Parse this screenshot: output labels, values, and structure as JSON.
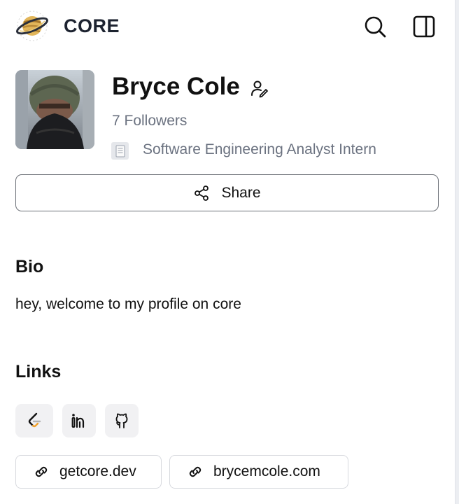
{
  "header": {
    "brand": "CORE",
    "logo_icon": "planet-logo-icon",
    "search_icon": "search-icon",
    "sidebar_icon": "sidebar-toggle-icon"
  },
  "profile": {
    "name": "Bryce Cole",
    "followers": "7 Followers",
    "role": "Software Engineering Analyst Intern",
    "avatar_icon": "profile-photo",
    "edit_icon": "user-edit-icon"
  },
  "share": {
    "label": "Share",
    "icon": "share-icon"
  },
  "bio": {
    "title": "Bio",
    "text": "hey, welcome to my profile on core"
  },
  "links": {
    "title": "Links",
    "social": [
      {
        "icon": "leetcode-icon"
      },
      {
        "icon": "linkedin-icon"
      },
      {
        "icon": "github-icon"
      }
    ],
    "urls": [
      {
        "label": "getcore.dev",
        "icon": "link-icon"
      },
      {
        "label": "brycemcole.com",
        "icon": "link-icon"
      }
    ]
  },
  "colors": {
    "text": "#111111",
    "muted": "#6b7280",
    "brand_text": "#1d2330",
    "tile_bg": "#f1f1f3",
    "border": "#6b6f76"
  }
}
